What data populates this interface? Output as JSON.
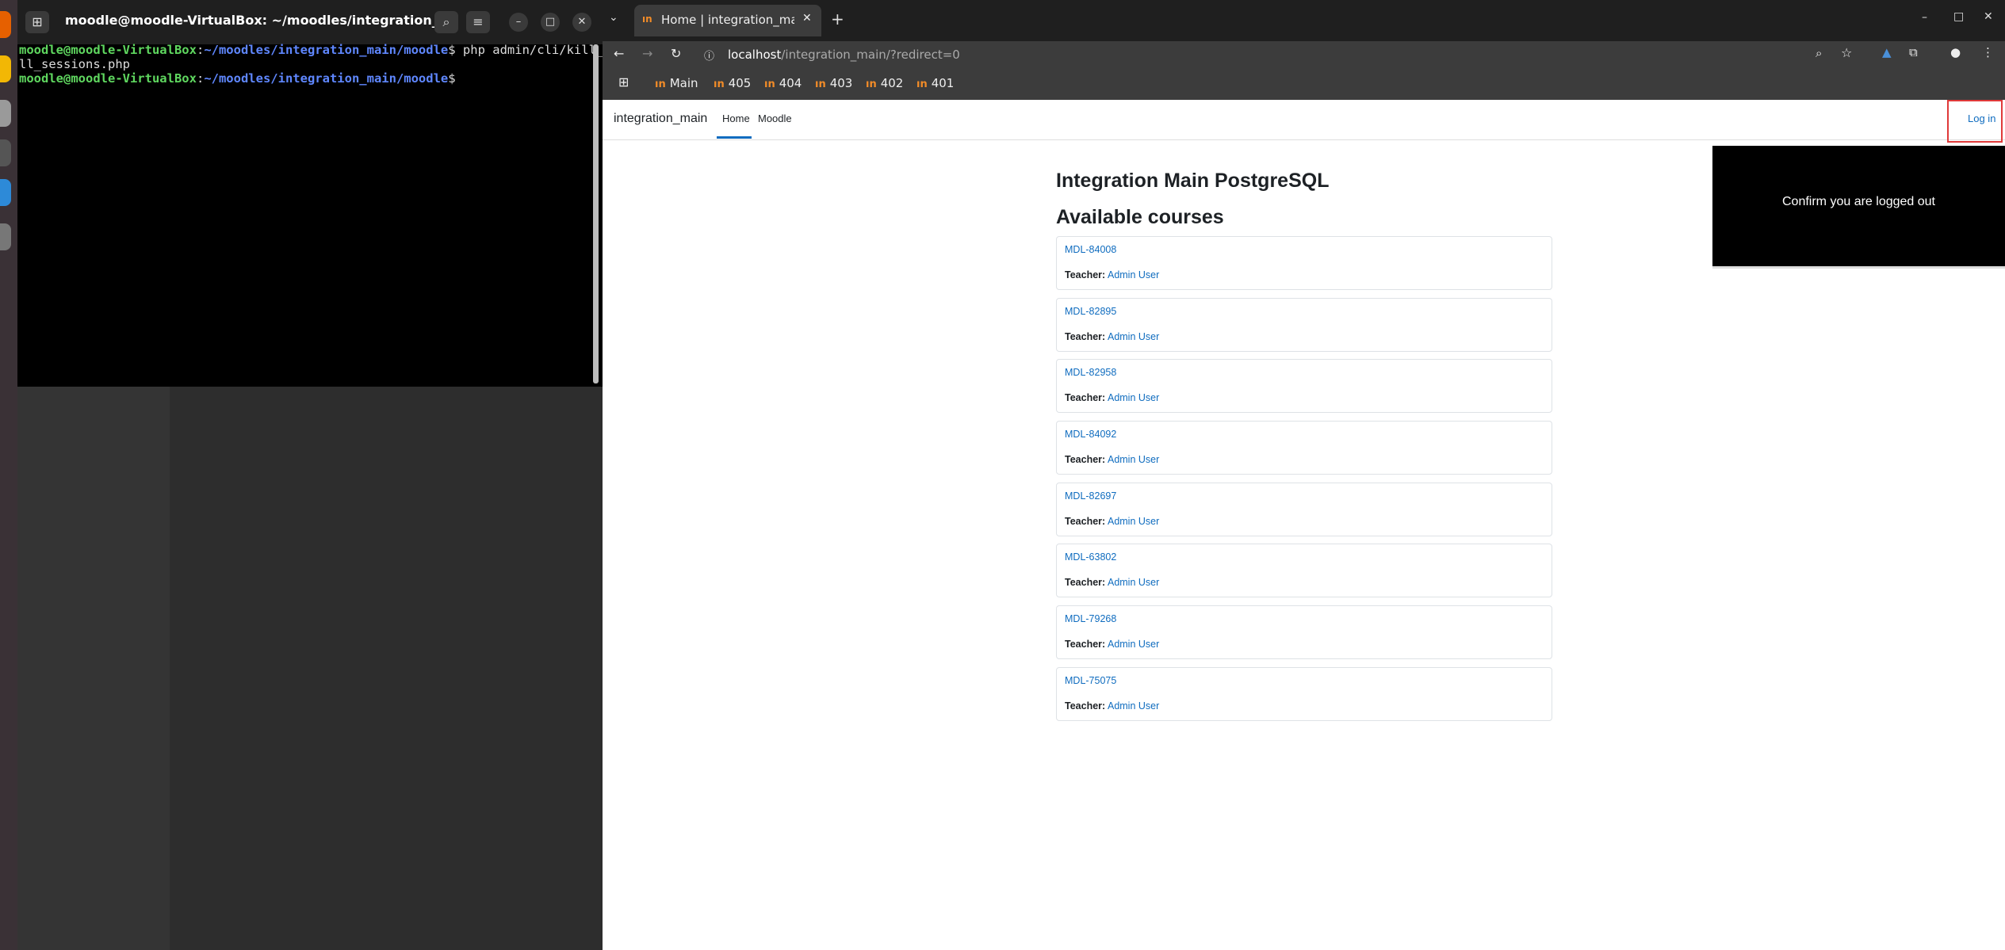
{
  "terminal": {
    "title": "moodle@moodle-VirtualBox: ~/moodles/integration_main/...",
    "lines": [
      {
        "user": "moodle@moodle-VirtualBox",
        "path": "~/moodles/integration_main/moodle",
        "cmd": "$ php admin/cli/kill_a"
      },
      {
        "text": "ll_sessions.php"
      },
      {
        "user": "moodle@moodle-VirtualBox",
        "path": "~/moodles/integration_main/moodle",
        "cmd": "$"
      }
    ],
    "sep": ":"
  },
  "browser": {
    "tab_title": "Home | integration_main",
    "url_host": "localhost",
    "url_path": "/integration_main/?redirect=0",
    "bookmarks": [
      "Main",
      "405",
      "404",
      "403",
      "402",
      "401"
    ],
    "bookmark_mark": "ın"
  },
  "site": {
    "name": "integration_main",
    "nav": {
      "home": "Home",
      "moodle": "Moodle"
    },
    "login": "Log in",
    "popup": "Confirm you are logged out",
    "heading": "Integration Main PostgreSQL",
    "courses_heading": "Available courses",
    "teacher_label": "Teacher:",
    "courses": [
      {
        "name": "MDL-84008",
        "teacher": "Admin User"
      },
      {
        "name": "MDL-82895",
        "teacher": "Admin User"
      },
      {
        "name": "MDL-82958",
        "teacher": "Admin User"
      },
      {
        "name": "MDL-84092",
        "teacher": "Admin User"
      },
      {
        "name": "MDL-82697",
        "teacher": "Admin User"
      },
      {
        "name": "MDL-63802",
        "teacher": "Admin User"
      },
      {
        "name": "MDL-79268",
        "teacher": "Admin User"
      },
      {
        "name": "MDL-75075",
        "teacher": "Admin User"
      }
    ]
  },
  "colors": {
    "accent": "#0f6cbf",
    "highlight": "#e03a3a",
    "prompt_user": "#5fd75f",
    "prompt_path": "#5f87ff"
  }
}
